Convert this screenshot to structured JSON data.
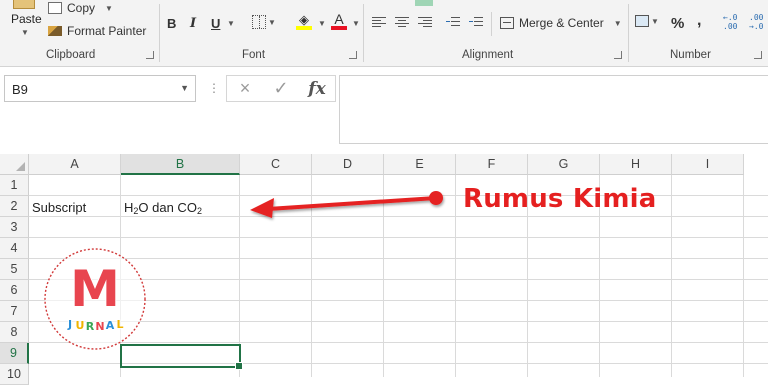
{
  "ribbon": {
    "clipboard": {
      "paste_label": "Paste",
      "copy_label": "Copy",
      "format_painter_label": "Format Painter",
      "group_label": "Clipboard"
    },
    "font": {
      "bold": "B",
      "italic": "I",
      "underline": "U",
      "font_color_letter": "A",
      "group_label": "Font",
      "highlight_color": "#ffff00",
      "font_color": "#e81123"
    },
    "alignment": {
      "merge_center_label": "Merge & Center",
      "group_label": "Alignment"
    },
    "number": {
      "percent_symbol": "%",
      "comma_symbol": ",",
      "increase_decimal": "←.0\n.00",
      "decrease_decimal": ".00\n→.0",
      "group_label": "Number"
    }
  },
  "formula_bar": {
    "name_box_value": "B9",
    "cancel_icon": "×",
    "enter_icon": "✓",
    "function_icon": "fx",
    "formula_value": ""
  },
  "grid": {
    "columns": [
      "A",
      "B",
      "C",
      "D",
      "E",
      "F",
      "G",
      "H",
      "I"
    ],
    "selected_column": "B",
    "rows": [
      "1",
      "2",
      "3",
      "4",
      "5",
      "6",
      "7",
      "8",
      "9",
      "10"
    ],
    "selected_row": "9",
    "cells": {
      "A2": "Subscript",
      "B2_parts": [
        "H",
        "2",
        "O dan CO",
        "2"
      ]
    }
  },
  "annotation": {
    "label": "Rumus Kimia",
    "color": "#e52020"
  },
  "watermark": {
    "letter": "M",
    "text": "JURNAL"
  },
  "colors": {
    "accent": "#217346",
    "ribbon_bg": "#f3f3f3"
  }
}
